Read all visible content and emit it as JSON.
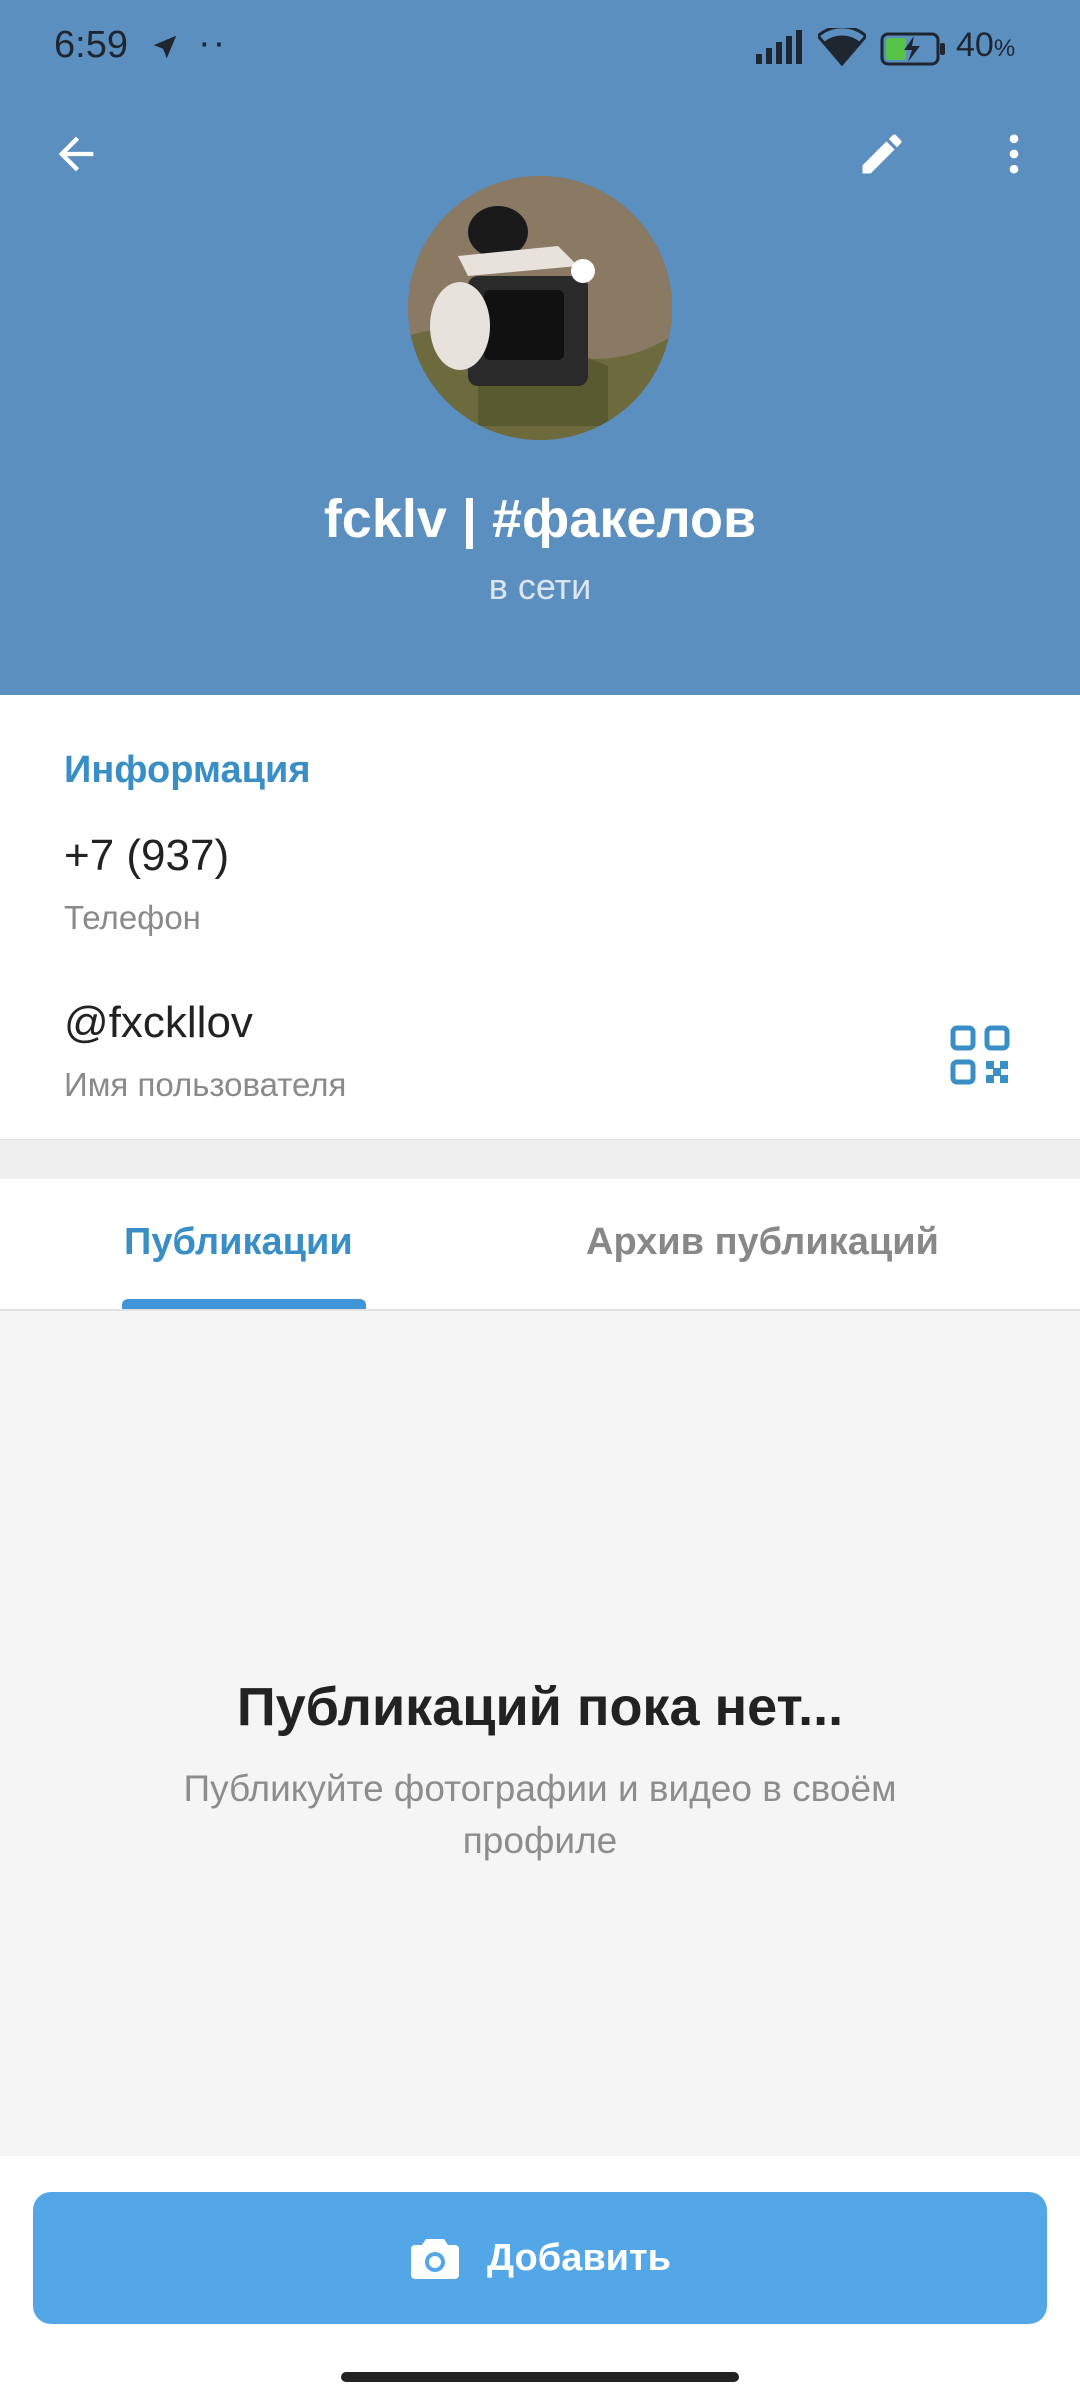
{
  "status_bar": {
    "time": "6:59",
    "dots": "··",
    "battery_percent": "40",
    "battery_unit": "%",
    "icons": [
      "navigation-icon",
      "signal-icon",
      "wifi-icon",
      "battery-icon"
    ]
  },
  "header": {
    "profile_name": "fcklv | #факелов",
    "status": "в сети",
    "background_color": "#5b8fbf"
  },
  "info": {
    "title": "Информация",
    "phone_value": "+7 (937)",
    "phone_label": "Телефон",
    "username_value": "@fxckllov",
    "username_label": "Имя пользователя"
  },
  "tabs": [
    {
      "label": "Публикации",
      "active": true
    },
    {
      "label": "Архив публикаций",
      "active": false
    }
  ],
  "empty_state": {
    "title": "Публикаций пока нет...",
    "subtitle": "Публикуйте фотографии и видео в своём профиле"
  },
  "action": {
    "add_label": "Добавить",
    "button_color": "#53a7e6"
  }
}
